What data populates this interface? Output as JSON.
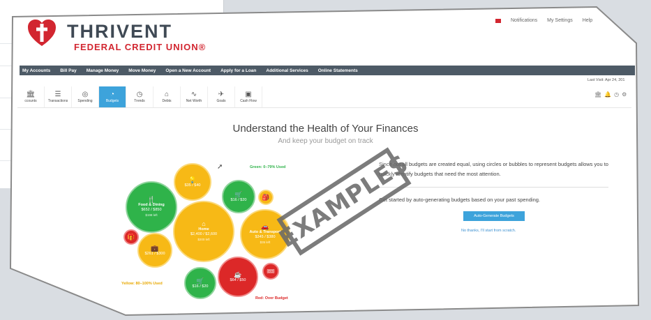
{
  "brand": {
    "name": "THRIVENT",
    "sub": "FEDERAL CREDIT UNION®"
  },
  "toplinks": [
    "Notifications",
    "My Settings",
    "Help"
  ],
  "nav": [
    "My Accounts",
    "Bill Pay",
    "Manage Money",
    "Move Money",
    "Open a New Account",
    "Apply for a Loan",
    "Additional Services",
    "Online Statements"
  ],
  "last_visit": "Last Visit: Apr 24, 201",
  "toolbar": [
    {
      "label": "ccounts",
      "icon": "🏛"
    },
    {
      "label": "Transactions",
      "icon": "☰"
    },
    {
      "label": "Spending",
      "icon": "◎"
    },
    {
      "label": "Budgets",
      "icon": "◔"
    },
    {
      "label": "Trends",
      "icon": "◷"
    },
    {
      "label": "Debts",
      "icon": "⌂"
    },
    {
      "label": "Net Worth",
      "icon": "∿"
    },
    {
      "label": "Goals",
      "icon": "✈"
    },
    {
      "label": "Cash Flow",
      "icon": "▣"
    }
  ],
  "right_icons": [
    "🏛",
    "🔔",
    "◷",
    "⚙"
  ],
  "main": {
    "title": "Understand the Health of Your Finances",
    "subtitle": "And keep your budget on track",
    "desc": "Since not all budgets are created equal, using circles or bubbles to represent budgets allows you to quickly identify budgets that need the most attention.",
    "get_started": "Get started by auto-generating budgets based on your past spending.",
    "auto_btn": "Auto-Generate Budgets",
    "no_thanks": "No thanks, I'll start from scratch."
  },
  "bubbles": {
    "food": {
      "name": "Food & Dining",
      "value": "$652 / $850",
      "left": "$198 left"
    },
    "home": {
      "name": "Home",
      "value": "$2,400 / $2,600",
      "left": "$200 left"
    },
    "auto": {
      "name": "Auto & Transport",
      "value": "$345 / $380",
      "left": "$35 left"
    },
    "b1": {
      "value": "$35 / $40"
    },
    "b2": {
      "value": "$16 / $20"
    },
    "b3": {
      "value": "$261 / $300"
    },
    "b4": {
      "value": "$64 / $50"
    },
    "b5": {
      "value": "$16 / $20"
    }
  },
  "legend": {
    "green": "Green: 0–79% Used",
    "yellow": "Yellow: 80–100% Used",
    "red": "Red: Over Budget"
  },
  "stamp": "EXAMPLES",
  "colors": {
    "brand_red": "#d22630",
    "nav": "#4d5a66",
    "accent": "#3da3db",
    "green": "#2fb34a",
    "yellow": "#f7b916",
    "red": "#dc2828"
  }
}
